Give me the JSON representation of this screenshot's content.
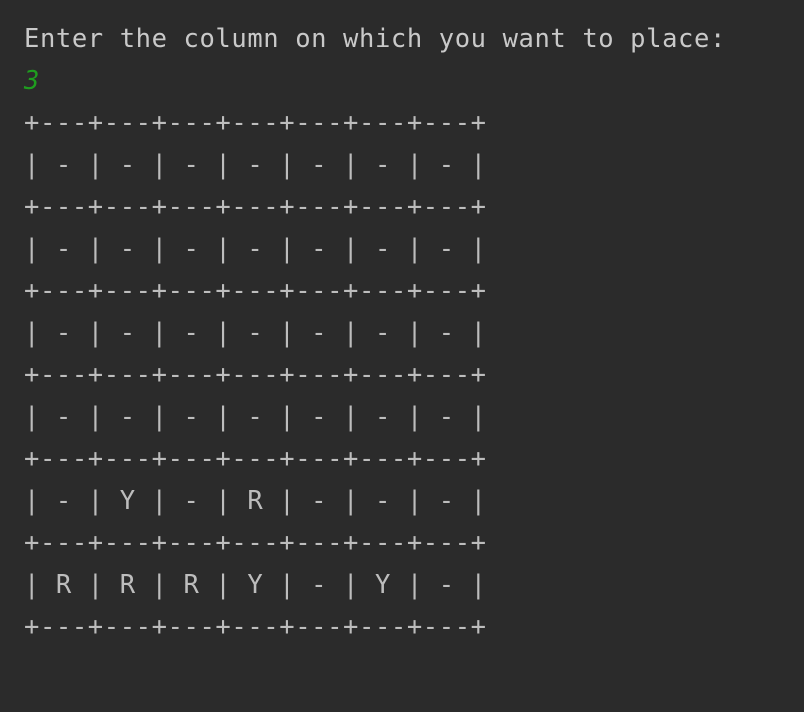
{
  "console": {
    "prompt": "Enter the column on which you want to place:",
    "user_input": "3",
    "board_lines": [
      "+---+---+---+---+---+---+---+",
      "| - | - | - | - | - | - | - |",
      "+---+---+---+---+---+---+---+",
      "| - | - | - | - | - | - | - |",
      "+---+---+---+---+---+---+---+",
      "| - | - | - | - | - | - | - |",
      "+---+---+---+---+---+---+---+",
      "| - | - | - | - | - | - | - |",
      "+---+---+---+---+---+---+---+",
      "| - | Y | - | R | - | - | - |",
      "+---+---+---+---+---+---+---+",
      "| R | R | R | Y | - | Y | - |",
      "+---+---+---+---+---+---+---+"
    ]
  },
  "colors": {
    "background": "#2b2b2b",
    "text": "#c9c9c9",
    "input_text": "#1f9d1f"
  }
}
